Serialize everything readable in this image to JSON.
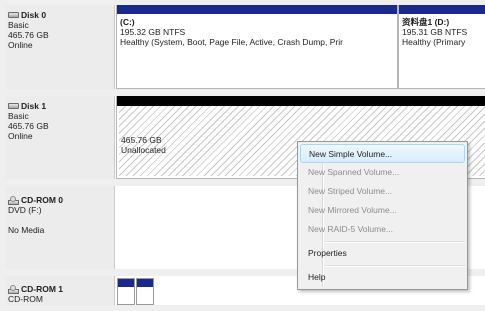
{
  "disks": [
    {
      "name": "Disk 0",
      "icon": "hard-disk-icon",
      "type": "Basic",
      "size": "465.76 GB",
      "status": "Online"
    },
    {
      "name": "Disk 1",
      "icon": "hard-disk-icon",
      "type": "Basic",
      "size": "465.76 GB",
      "status": "Online"
    },
    {
      "name": "CD-ROM 0",
      "icon": "cd-rom-icon",
      "type": "DVD (F:)",
      "status": "No Media"
    },
    {
      "name": "CD-ROM 1",
      "icon": "cd-rom-icon",
      "type": "CD-ROM"
    }
  ],
  "volumes": {
    "c": {
      "name": "(C:)",
      "size": "195.32 GB NTFS",
      "status": "Healthy (System, Boot, Page File, Active, Crash Dump, Prir"
    },
    "d": {
      "name": "资料盘1 (D:)",
      "size": "195.31 GB NTFS",
      "status": "Healthy (Primary"
    },
    "unallocated": {
      "size": "465.76 GB",
      "status": "Unallocated"
    }
  },
  "context_menu": {
    "items": [
      {
        "label": "New Simple Volume...",
        "enabled": true,
        "highlighted": true
      },
      {
        "label": "New Spanned Volume...",
        "enabled": false
      },
      {
        "label": "New Striped Volume...",
        "enabled": false
      },
      {
        "label": "New Mirrored Volume...",
        "enabled": false
      },
      {
        "label": "New RAID-5 Volume...",
        "enabled": false
      },
      {
        "label": "Properties",
        "enabled": true
      },
      {
        "label": "Help",
        "enabled": true
      }
    ]
  },
  "colors": {
    "primary_partition": "#1a2a8c",
    "unallocated": "#000000",
    "menu_highlight": "#d6eefb"
  }
}
